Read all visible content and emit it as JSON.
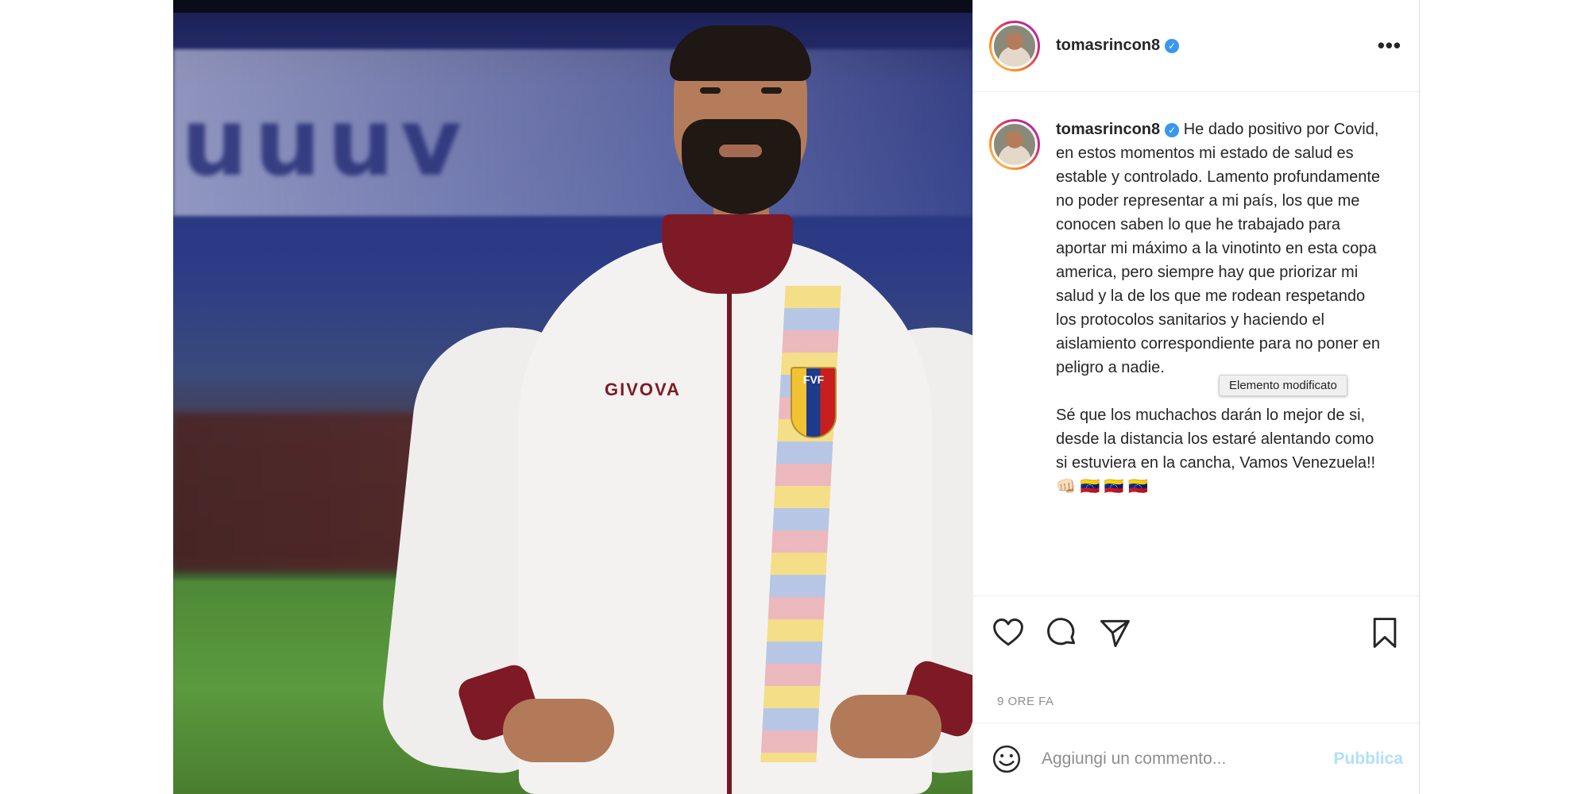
{
  "photo": {
    "banner_text": "uuuv",
    "jacket_brand": "GIVOVA",
    "crest_text": "FVF"
  },
  "post": {
    "username": "tomasrincon8",
    "verified_icon": "verified-badge-icon",
    "more_icon": "more-options-icon",
    "more_label": "•••",
    "caption_paragraphs": [
      "He dado positivo por Covid, en estos momentos mi estado de salud es estable y controlado. Lamento profundamente no poder representar a mi país, los que me conocen saben lo que he trabajado para aportar mi máximo a la vinotinto en esta copa america, pero siempre hay que priorizar mi salud y la de los que me rodean respetando los protocolos sanitarios y haciendo el aislamiento correspondiente para no poner en peligro a nadie.",
      "Sé que los muchachos darán lo mejor de si, desde la distancia los estaré alentando como si estuviera en la cancha, Vamos Venezuela!! 👊🏻 🇻🇪 🇻🇪 🇻🇪"
    ],
    "tooltip": "Elemento modificato",
    "timestamp": "9 ORE FA",
    "actions": [
      "heart-icon",
      "comment-icon",
      "share-icon",
      "bookmark-icon"
    ],
    "comment_placeholder": "Aggiungi un commento...",
    "publish_label": "Pubblica",
    "colors": {
      "verified": "#3897f0",
      "publish_disabled": "#b2dffc",
      "meta_text": "#8e8e8e"
    }
  }
}
